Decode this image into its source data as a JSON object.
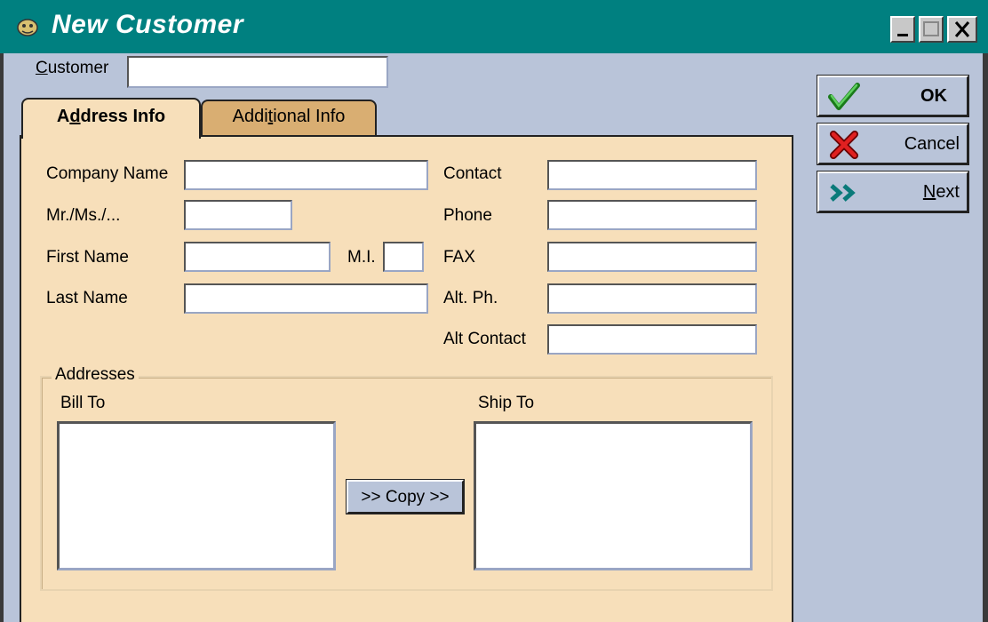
{
  "window": {
    "title": "New Customer",
    "controls": [
      "minimize",
      "maximize",
      "close"
    ]
  },
  "customer": {
    "label": "Customer",
    "mnemonic": "C",
    "rest": "ustomer",
    "value": ""
  },
  "tabs": [
    {
      "label": "Address Info",
      "pre": "A",
      "mn": "d",
      "post": "dress Info",
      "selected": true
    },
    {
      "label": "Additional Info",
      "pre": "Addi",
      "mn": "t",
      "post": "ional Info",
      "selected": false
    }
  ],
  "address_info": {
    "company_name_label": "Company Name",
    "salutation_label": "Mr./Ms./...",
    "first_name_label": "First Name",
    "mi_label": "M.I.",
    "last_name_label": "Last Name",
    "contact_label": "Contact",
    "phone_label": "Phone",
    "fax_label": "FAX",
    "alt_phone_label": "Alt. Ph.",
    "alt_contact_label": "Alt Contact"
  },
  "addresses": {
    "group_label": "Addresses",
    "bill_to_label": "Bill To",
    "ship_to_label": "Ship To",
    "copy_label": ">> Copy >>"
  },
  "buttons": {
    "ok": "OK",
    "cancel": "Cancel",
    "next_mn": "N",
    "next_rest": "ext"
  },
  "colors": {
    "titlebar": "#008080",
    "background": "#b9c4d9",
    "tab_panel": "#f7dfba",
    "inactive_tab": "#d9ae72"
  }
}
